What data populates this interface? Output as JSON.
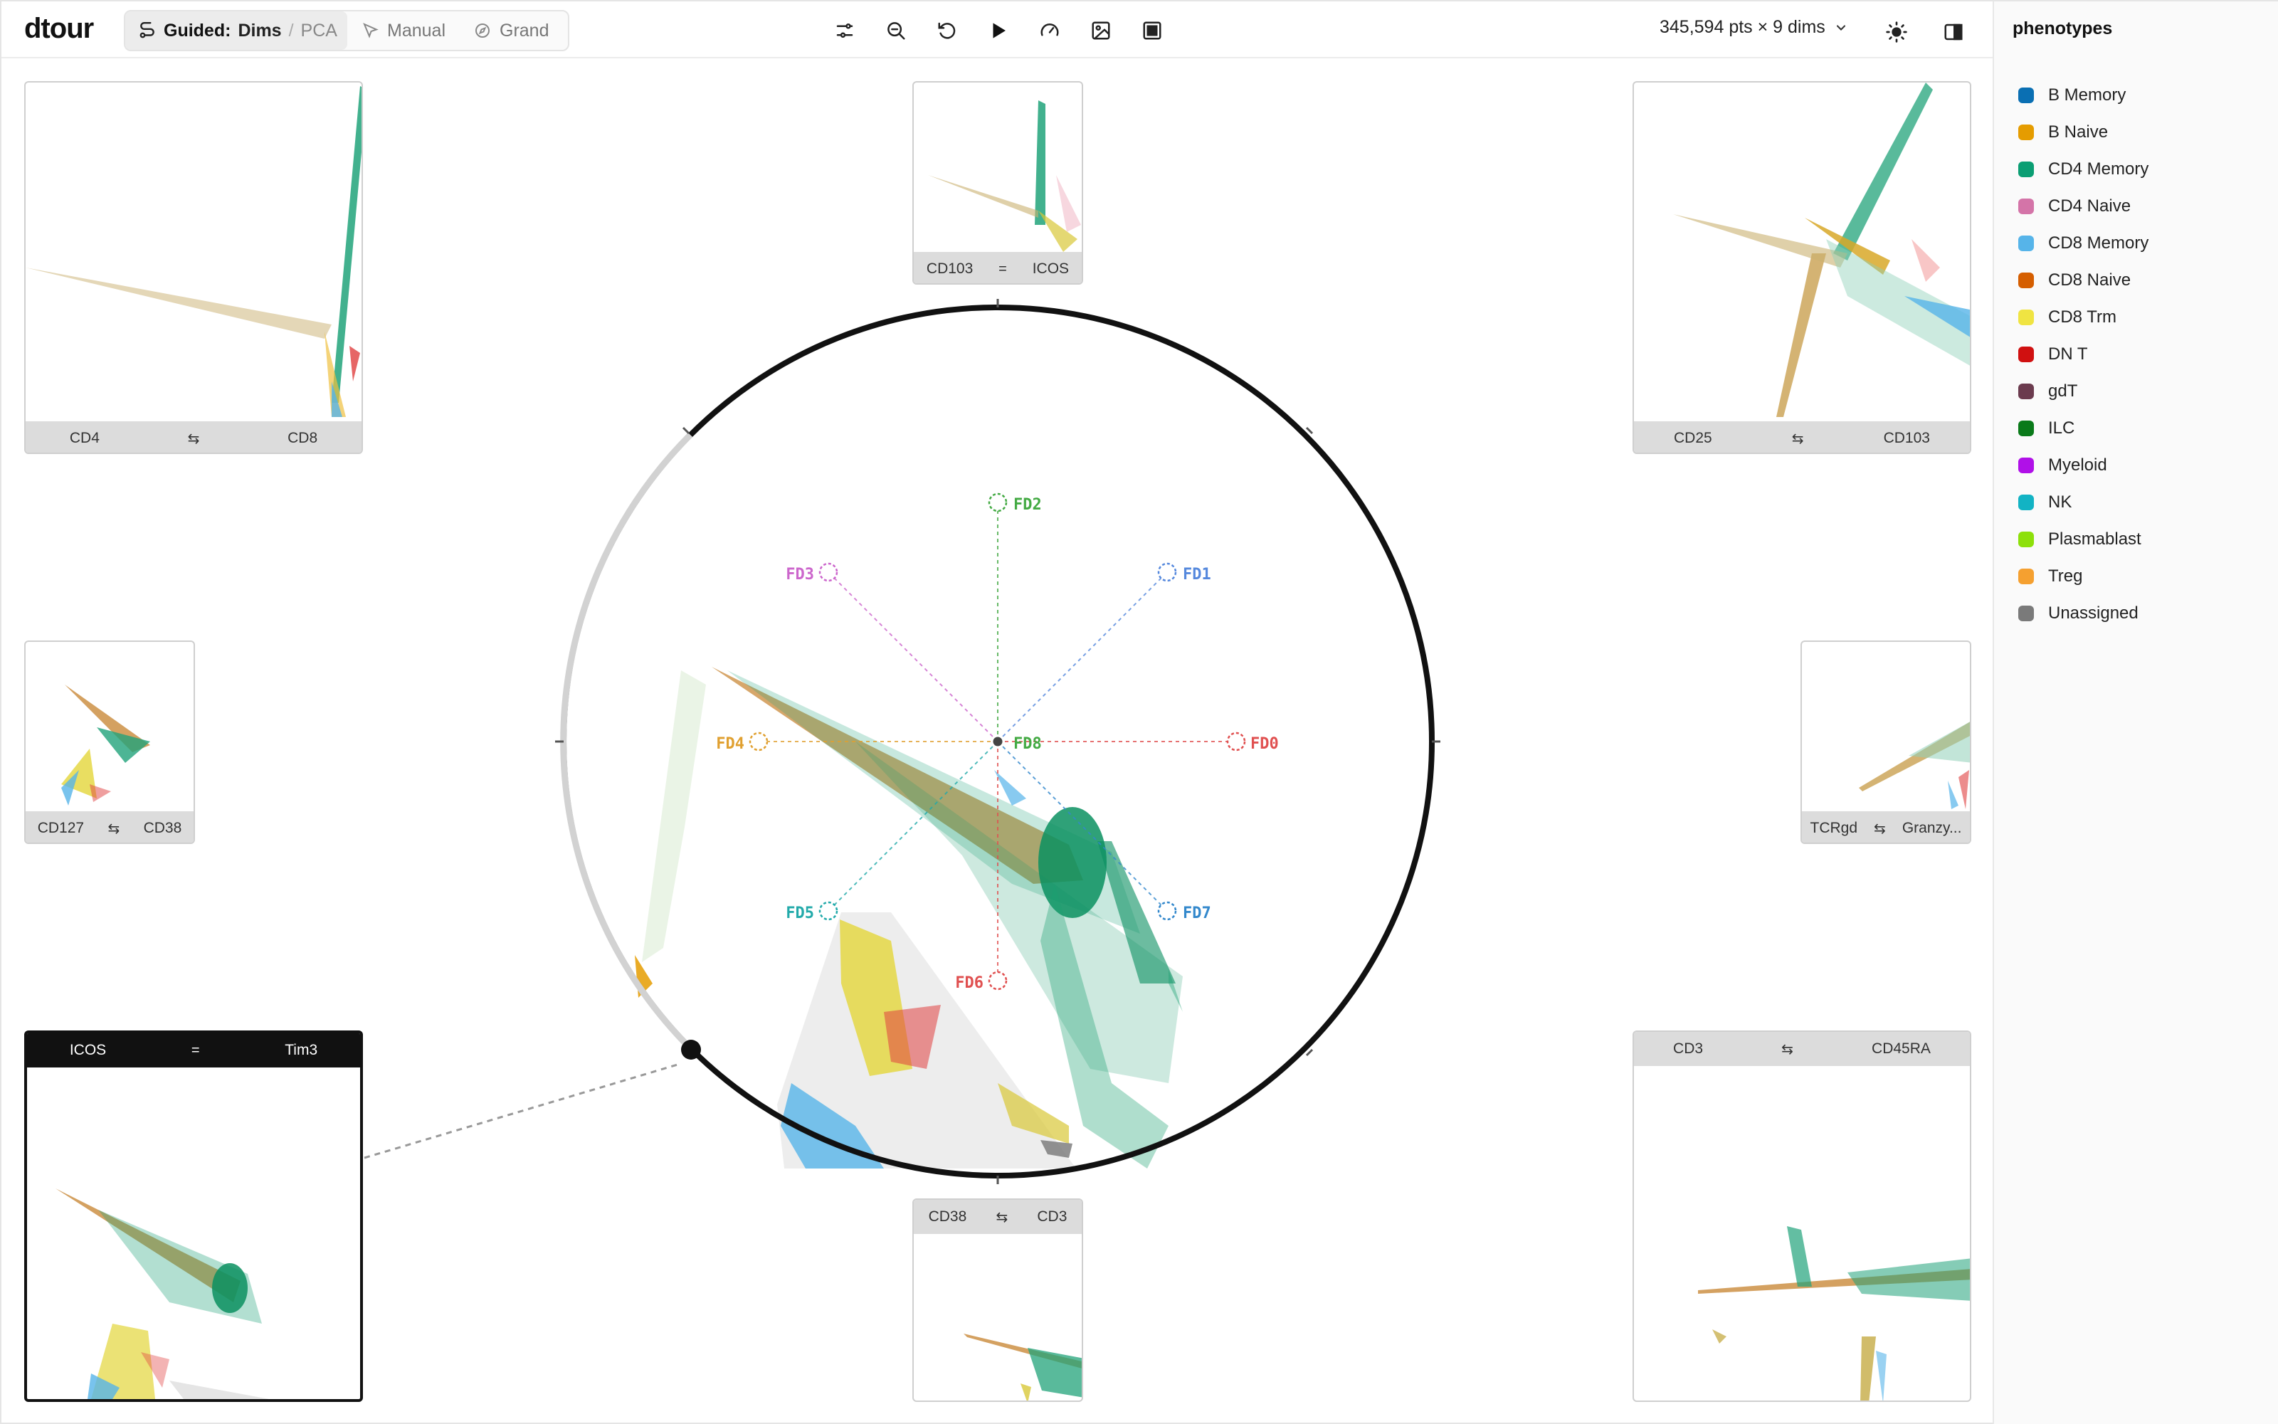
{
  "app": {
    "logo": "dtour",
    "modes": {
      "guided_label": "Guided:",
      "guided_dims": "Dims",
      "guided_sep": "/",
      "guided_pca": "PCA",
      "manual": "Manual",
      "grand": "Grand"
    },
    "points_label": "345,594 pts × 9 dims"
  },
  "sidebar": {
    "title": "phenotypes",
    "items": [
      {
        "label": "B Memory",
        "color": "#0a6fb3"
      },
      {
        "label": "B Naive",
        "color": "#e59c00"
      },
      {
        "label": "CD4 Memory",
        "color": "#0a9e73"
      },
      {
        "label": "CD4 Naive",
        "color": "#d474a8"
      },
      {
        "label": "CD8 Memory",
        "color": "#56b4e9"
      },
      {
        "label": "CD8 Naive",
        "color": "#d55e00"
      },
      {
        "label": "CD8 Trm",
        "color": "#f0e442"
      },
      {
        "label": "DN T",
        "color": "#d01010"
      },
      {
        "label": "gdT",
        "color": "#6b3b4e"
      },
      {
        "label": "ILC",
        "color": "#0a7a1a"
      },
      {
        "label": "Myeloid",
        "color": "#b010e8"
      },
      {
        "label": "NK",
        "color": "#12b3c4"
      },
      {
        "label": "Plasmablast",
        "color": "#8de00a"
      },
      {
        "label": "Treg",
        "color": "#f5a030"
      },
      {
        "label": "Unassigned",
        "color": "#7a7a7a"
      }
    ]
  },
  "thumbnails": [
    {
      "a": "CD4",
      "b": "CD8",
      "link": "⇆"
    },
    {
      "a": "CD103",
      "b": "ICOS",
      "link": "="
    },
    {
      "a": "CD25",
      "b": "CD103",
      "link": "⇆"
    },
    {
      "a": "CD127",
      "b": "CD38",
      "link": "⇆"
    },
    {
      "a": "TCRgd",
      "b": "Granzy...",
      "link": "⇆"
    },
    {
      "a": "ICOS",
      "b": "Tim3",
      "link": "="
    },
    {
      "a": "CD38",
      "b": "CD3",
      "link": "⇆"
    },
    {
      "a": "CD3",
      "b": "CD45RA",
      "link": "⇆"
    }
  ],
  "axes": [
    {
      "label": "FD0",
      "color": "#e05050"
    },
    {
      "label": "FD1",
      "color": "#5588dd"
    },
    {
      "label": "FD2",
      "color": "#44aa44"
    },
    {
      "label": "FD3",
      "color": "#cc66cc"
    },
    {
      "label": "FD4",
      "color": "#e0a030"
    },
    {
      "label": "FD5",
      "color": "#22aaaa"
    },
    {
      "label": "FD6",
      "color": "#e05050"
    },
    {
      "label": "FD7",
      "color": "#3388cc"
    },
    {
      "label": "FD8",
      "color": "#44aa44"
    }
  ]
}
